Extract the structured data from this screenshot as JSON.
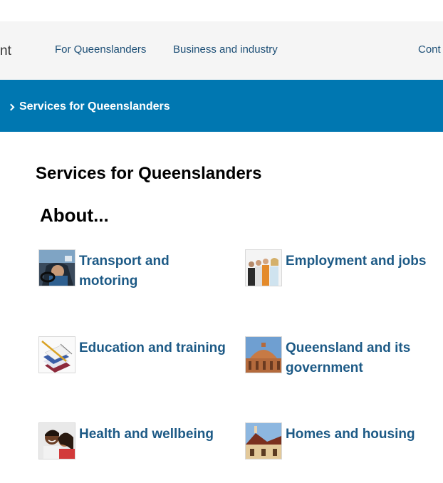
{
  "header": {
    "logo_fragment": "nt",
    "nav": [
      {
        "label": "For Queenslanders"
      },
      {
        "label": "Business and industry"
      },
      {
        "label": "Cont"
      }
    ]
  },
  "breadcrumb": {
    "current": "Services for Queenslanders"
  },
  "main": {
    "title": "Services for Queenslanders",
    "section_title": "About...",
    "tiles": [
      {
        "label": "Transport and motoring",
        "icon": "car-driver-photo"
      },
      {
        "label": "Employment and jobs",
        "icon": "workers-group-photo"
      },
      {
        "label": "Education and training",
        "icon": "books-pencil-photo"
      },
      {
        "label": "Queensland and its government",
        "icon": "parliament-dome-photo"
      },
      {
        "label": "Health and wellbeing",
        "icon": "smiling-couple-photo"
      },
      {
        "label": "Homes and housing",
        "icon": "house-roof-photo"
      }
    ]
  },
  "colors": {
    "topbar_bg": "#f5f5f5",
    "breadcrumb_bg": "#0077b1",
    "link": "#1d5a86"
  }
}
